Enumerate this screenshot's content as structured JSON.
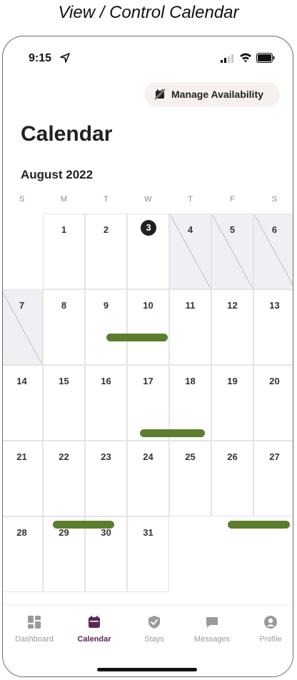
{
  "caption": "View / Control Calendar",
  "status": {
    "time": "9:15"
  },
  "header": {
    "manage_label": "Manage Availability"
  },
  "page_title": "Calendar",
  "month_label": "August 2022",
  "weekdays": [
    "S",
    "M",
    "T",
    "W",
    "T",
    "F",
    "S"
  ],
  "calendar": {
    "today": 3,
    "blocked_days": [
      4,
      5,
      6,
      7
    ],
    "weeks": [
      [
        "",
        "1",
        "2",
        "3",
        "4",
        "5",
        "6"
      ],
      [
        "7",
        "8",
        "9",
        "10",
        "11",
        "12",
        "13"
      ],
      [
        "14",
        "15",
        "16",
        "17",
        "18",
        "19",
        "20"
      ],
      [
        "21",
        "22",
        "23",
        "24",
        "25",
        "26",
        "27"
      ],
      [
        "28",
        "29",
        "30",
        "31",
        "",
        "",
        ""
      ]
    ],
    "stays_count": 4
  },
  "tabs": [
    {
      "label": "Dashboard",
      "icon": "dashboard-icon",
      "active": false
    },
    {
      "label": "Calendar",
      "icon": "calendar-icon",
      "active": true
    },
    {
      "label": "Stays",
      "icon": "stays-icon",
      "active": false
    },
    {
      "label": "Messages",
      "icon": "messages-icon",
      "active": false
    },
    {
      "label": "Profile",
      "icon": "profile-icon",
      "active": false
    }
  ],
  "colors": {
    "accent": "#5a2a55",
    "stay_bar": "#5b7e2d",
    "blocked": "#f0eff4",
    "manage_bg": "#f6f1ee"
  }
}
